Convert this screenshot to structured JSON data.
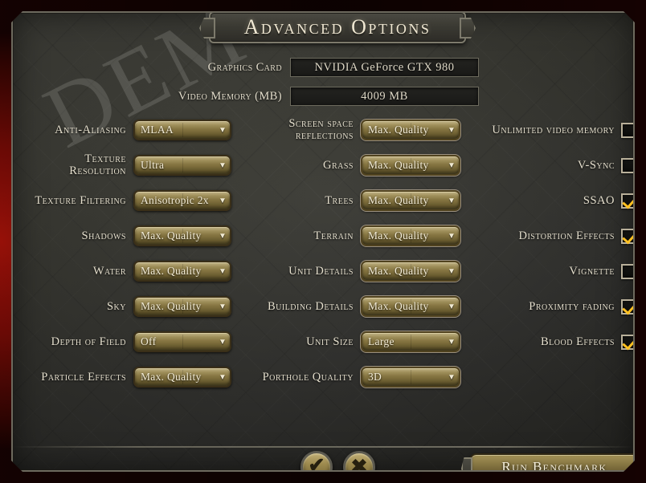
{
  "window": {
    "title": "Advanced Options",
    "watermark": "DEMUEMEDIA"
  },
  "system_info": [
    {
      "label": "Graphics Card",
      "value": "NVIDIA GeForce GTX 980"
    },
    {
      "label": "Video Memory (MB)",
      "value": "4009 MB"
    }
  ],
  "columns": {
    "left": [
      {
        "label": "Anti-Aliasing",
        "value": "MLAA"
      },
      {
        "label": "Texture Resolution",
        "value": "Ultra"
      },
      {
        "label": "Texture Filtering",
        "value": "Anisotropic 2x"
      },
      {
        "label": "Shadows",
        "value": "Max. Quality"
      },
      {
        "label": "Water",
        "value": "Max. Quality"
      },
      {
        "label": "Sky",
        "value": "Max. Quality"
      },
      {
        "label": "Depth of Field",
        "value": "Off"
      },
      {
        "label": "Particle Effects",
        "value": "Max. Quality"
      }
    ],
    "middle": [
      {
        "label": "Screen space reflections",
        "value": "Max. Quality"
      },
      {
        "label": "Grass",
        "value": "Max. Quality"
      },
      {
        "label": "Trees",
        "value": "Max. Quality"
      },
      {
        "label": "Terrain",
        "value": "Max. Quality"
      },
      {
        "label": "Unit Details",
        "value": "Max. Quality"
      },
      {
        "label": "Building Details",
        "value": "Max. Quality"
      },
      {
        "label": "Unit Size",
        "value": "Large"
      },
      {
        "label": "Porthole Quality",
        "value": "3D"
      }
    ],
    "right": [
      {
        "label": "Unlimited video memory",
        "checked": false
      },
      {
        "label": "V-Sync",
        "checked": false
      },
      {
        "label": "SSAO",
        "checked": true
      },
      {
        "label": "Distortion Effects",
        "checked": true
      },
      {
        "label": "Vignette",
        "checked": false
      },
      {
        "label": "Proximity fading",
        "checked": true
      },
      {
        "label": "Blood Effects",
        "checked": true
      }
    ]
  },
  "footer": {
    "accept_glyph": "✔",
    "cancel_glyph": "✖",
    "benchmark_label": "Run Benchmark"
  },
  "icons": {
    "dropdown_arrow": "▼"
  },
  "colors": {
    "accent_gold": "#95844c",
    "check_yellow": "#ffc021",
    "panel_stone": "#3a3a33",
    "backdrop_red": "#c9160b"
  }
}
